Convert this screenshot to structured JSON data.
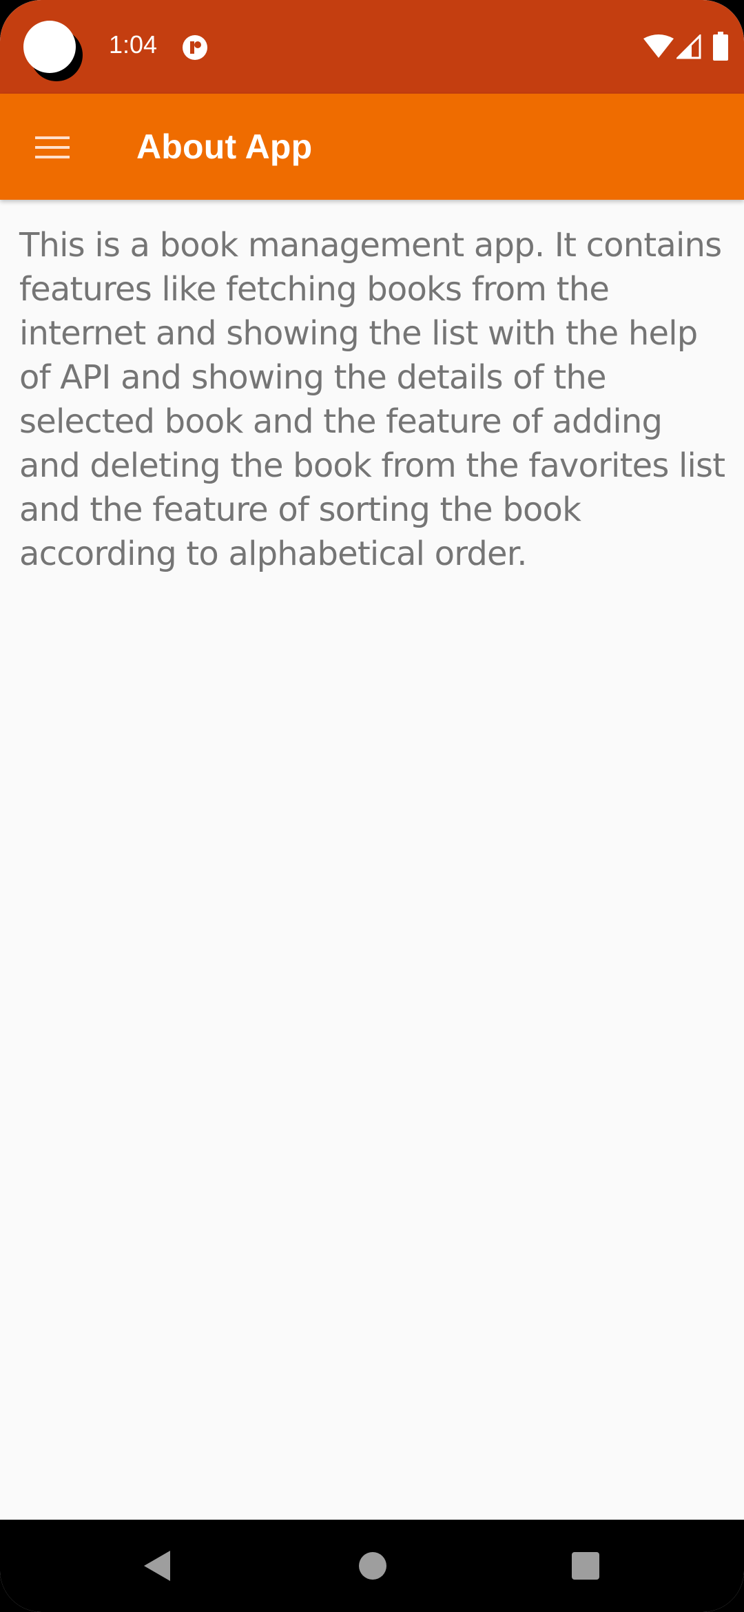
{
  "status_bar": {
    "time": "1:04",
    "icons": [
      "camera-cutout",
      "notification-icon",
      "wifi-icon",
      "cellular-signal-icon",
      "battery-icon"
    ]
  },
  "app_bar": {
    "title": "About App",
    "menu_icon": "hamburger-menu-icon"
  },
  "content": {
    "about_text": "This is a book management app. It contains features like fetching books from the internet and showing the list with the help of API and showing the details of the selected book and the feature of adding and deleting the book from the favorites list and the feature of sorting the book according to alphabetical order."
  },
  "nav_bar": {
    "buttons": [
      "back-icon",
      "home-icon",
      "recents-icon"
    ]
  },
  "colors": {
    "status_bar": "#c43e10",
    "app_bar": "#ef6c00",
    "background": "#fafafa",
    "body_text": "#757575",
    "nav_bar": "#000000"
  }
}
